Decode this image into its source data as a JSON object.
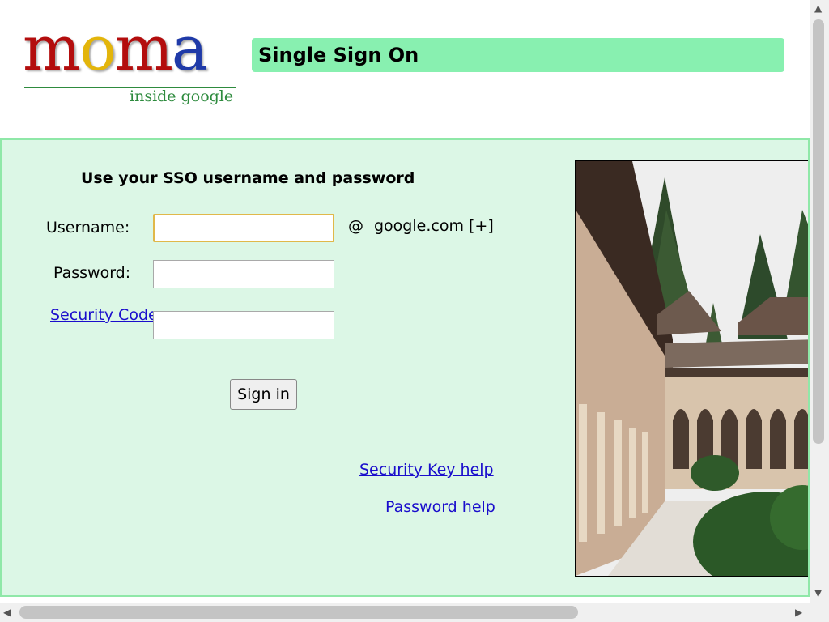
{
  "header": {
    "logo": {
      "text": "moma",
      "tagline": "inside google"
    },
    "title": "Single Sign On"
  },
  "form": {
    "title": "Use your SSO username and password",
    "username_label": "Username:",
    "username_value": "",
    "password_label": "Password:",
    "password_value": "",
    "security_code_link": "Security Code",
    "security_code_colon": ":",
    "security_code_value": "",
    "domain_at": "@",
    "domain": "google.com",
    "domain_expand": "[+]",
    "signin_label": "Sign in"
  },
  "links": {
    "security_key_help": "Security Key help",
    "password_help": "Password help"
  },
  "colors": {
    "banner": "#88f0b0",
    "panel": "#dcf7e6",
    "link": "#1a0dcc"
  }
}
